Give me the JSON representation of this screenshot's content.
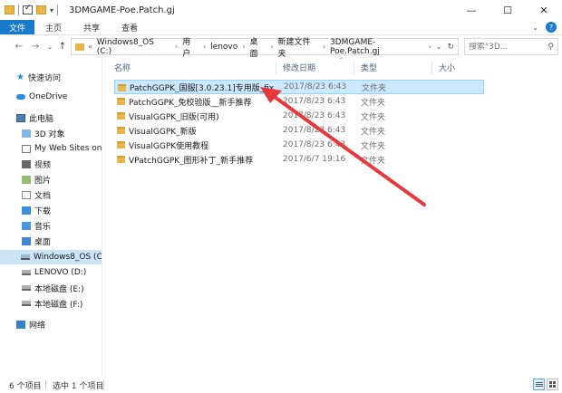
{
  "window": {
    "title": "3DMGAME-Poe.Patch.gj",
    "controls": {
      "minimize": "—",
      "maximize": "☐",
      "close": "✕"
    }
  },
  "ribbon": {
    "tabs": [
      "文件",
      "主页",
      "共享",
      "查看"
    ],
    "expand_icon": "chevron-down-icon",
    "help_label": "?"
  },
  "address": {
    "prefix": "«",
    "crumbs": [
      "Windows8_OS (C:)",
      "用户",
      "lenovo",
      "桌面",
      "新建文件夹",
      "3DMGAME-Poe.Patch.gj"
    ],
    "search_placeholder": "搜索\"3D...",
    "search_icon": "search-icon"
  },
  "sidebar": {
    "quick_access": "快速访问",
    "onedrive": "OneDrive",
    "this_pc": "此电脑",
    "items": [
      "3D 对象",
      "My Web Sites on M",
      "视频",
      "图片",
      "文档",
      "下载",
      "音乐",
      "桌面"
    ],
    "drives": [
      "Windows8_OS (C:)",
      "LENOVO (D:)",
      "本地磁盘 (E:)",
      "本地磁盘 (F:)"
    ],
    "network": "网络"
  },
  "columns": {
    "name": "名称",
    "date": "修改日期",
    "type": "类型",
    "size": "大小"
  },
  "files": [
    {
      "name": "PatchGGPK_国服[3.0.23.1]专用版_fix",
      "date": "2017/8/23 6:43",
      "type": "文件夹",
      "selected": true
    },
    {
      "name": "PatchGGPK_免校验版__新手推荐",
      "date": "2017/8/23 6:43",
      "type": "文件夹",
      "selected": false
    },
    {
      "name": "VisualGGPK_旧版(可用)",
      "date": "2017/8/23 6:43",
      "type": "文件夹",
      "selected": false
    },
    {
      "name": "VisualGGPK_新版",
      "date": "2017/8/23 6:43",
      "type": "文件夹",
      "selected": false
    },
    {
      "name": "VisualGGPK使用教程",
      "date": "2017/8/23 6:43",
      "type": "文件夹",
      "selected": false
    },
    {
      "name": "VPatchGGPK_图形补丁_新手推荐",
      "date": "2017/6/7 19:16",
      "type": "文件夹",
      "selected": false
    }
  ],
  "status": {
    "item_count": "6 个项目",
    "selected": "选中 1 个项目"
  },
  "annotation": {
    "arrow_color": "#e8383d"
  },
  "colors": {
    "accent": "#1979ca",
    "selection": "#cce8ff",
    "folder": "#e8b64a"
  }
}
